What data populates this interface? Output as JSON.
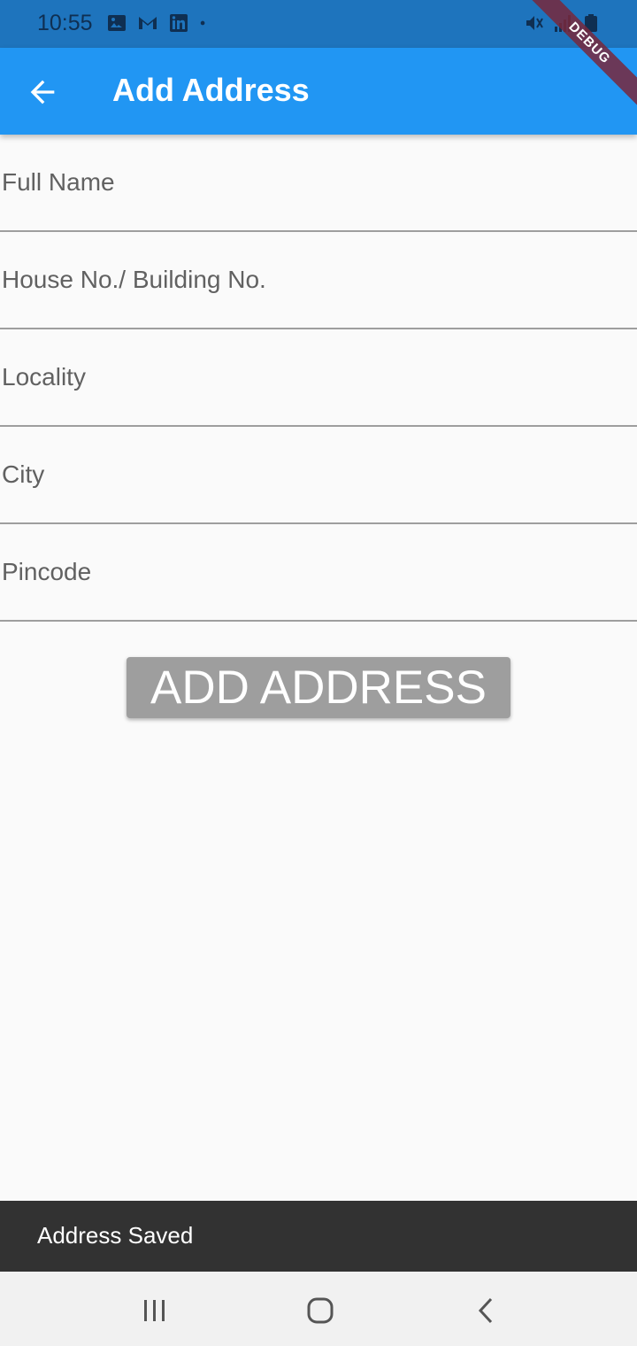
{
  "status_bar": {
    "time": "10:55",
    "left_icons": [
      "image-icon",
      "gmail-icon",
      "linkedin-icon",
      "notification-dot-icon"
    ],
    "right_icons": [
      "mute-icon",
      "signal-icon",
      "battery-icon"
    ],
    "background": "#1e74bd"
  },
  "debug_banner": {
    "label": "DEBUG"
  },
  "app_bar": {
    "title": "Add Address",
    "back_icon": "arrow-back-icon",
    "background": "#2196f3"
  },
  "form": {
    "fields": [
      {
        "placeholder": "Full Name",
        "value": ""
      },
      {
        "placeholder": "House No./ Building No.",
        "value": ""
      },
      {
        "placeholder": "Locality",
        "value": ""
      },
      {
        "placeholder": "City",
        "value": ""
      },
      {
        "placeholder": "Pincode",
        "value": ""
      }
    ],
    "submit_label": "ADD ADDRESS",
    "submit_color": "#9e9e9e"
  },
  "snackbar": {
    "message": "Address Saved"
  },
  "nav_bar": {
    "buttons": [
      "recent-apps-icon",
      "home-icon",
      "back-nav-icon"
    ]
  }
}
